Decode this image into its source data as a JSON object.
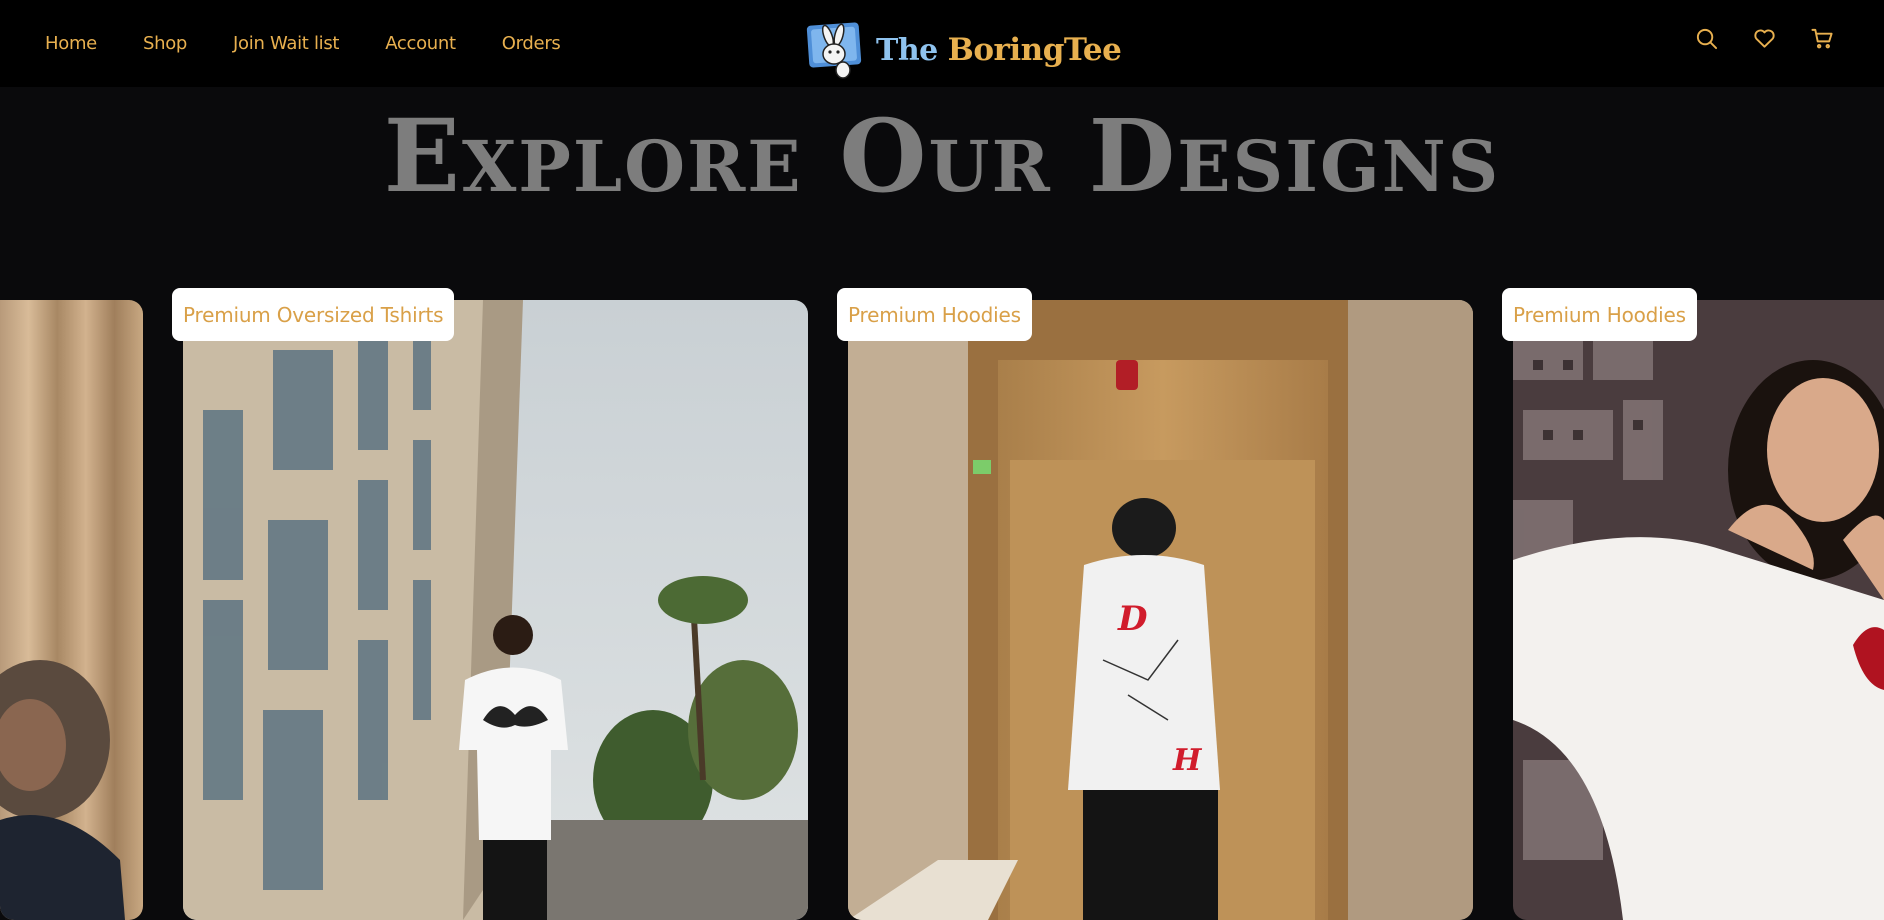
{
  "nav": {
    "items": [
      {
        "label": "Home"
      },
      {
        "label": "Shop"
      },
      {
        "label": "Join Wait list"
      },
      {
        "label": "Account"
      },
      {
        "label": "Orders"
      }
    ]
  },
  "brand": {
    "prefix": "The ",
    "name": "BoringTee"
  },
  "header_icons": [
    "search-icon",
    "heart-icon",
    "cart-icon"
  ],
  "hero": {
    "title": "Explore Our Designs"
  },
  "cards": [
    {
      "label": "Premium Oversized Tshirts"
    },
    {
      "label": "Premium Hoodies"
    },
    {
      "label": "Premium Hoodies"
    }
  ],
  "colors": {
    "accent": "#e8b04f",
    "background": "#0a0a0c",
    "header": "#000000",
    "title": "#7d7d7d"
  }
}
